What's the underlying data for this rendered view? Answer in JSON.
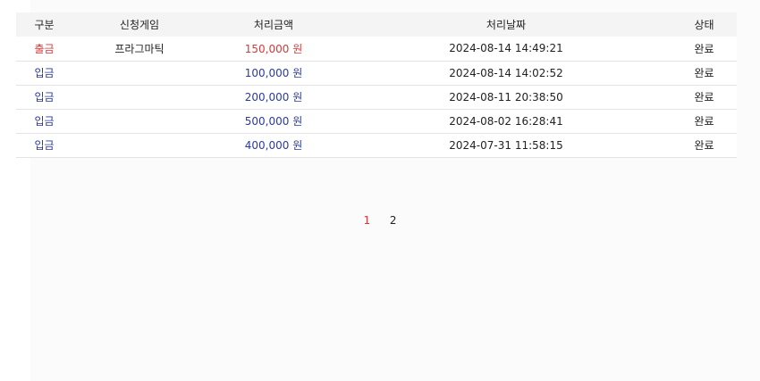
{
  "table": {
    "headers": [
      "구분",
      "신청게임",
      "처리금액",
      "처리날짜",
      "상태"
    ],
    "rows": [
      {
        "type": "출금",
        "game": "프라그마틱",
        "amount": "150,000 원",
        "date": "2024-08-14 14:49:21",
        "status": "완료"
      },
      {
        "type": "입금",
        "game": "",
        "amount": "100,000 원",
        "date": "2024-08-14 14:02:52",
        "status": "완료"
      },
      {
        "type": "입금",
        "game": "",
        "amount": "200,000 원",
        "date": "2024-08-11 20:38:50",
        "status": "완료"
      },
      {
        "type": "입금",
        "game": "",
        "amount": "500,000 원",
        "date": "2024-08-02 16:28:41",
        "status": "완료"
      },
      {
        "type": "입금",
        "game": "",
        "amount": "400,000 원",
        "date": "2024-07-31 11:58:15",
        "status": "완료"
      }
    ]
  },
  "pagination": {
    "pages": [
      "1",
      "2"
    ],
    "current": "1"
  },
  "colors": {
    "withdraw": "#d43a3a",
    "deposit": "#2a3aa0",
    "active_page": "#d43a3a"
  }
}
